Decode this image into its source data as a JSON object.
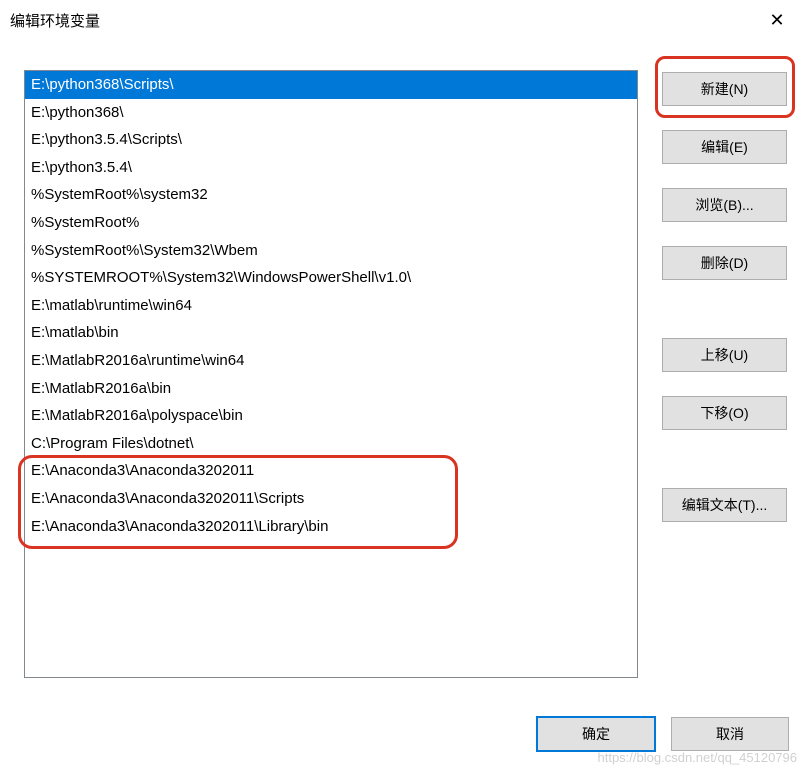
{
  "title": "编辑环境变量",
  "close_symbol": "✕",
  "list": {
    "selected_index": 0,
    "items": [
      "E:\\python368\\Scripts\\",
      "E:\\python368\\",
      "E:\\python3.5.4\\Scripts\\",
      "E:\\python3.5.4\\",
      "%SystemRoot%\\system32",
      "%SystemRoot%",
      "%SystemRoot%\\System32\\Wbem",
      "%SYSTEMROOT%\\System32\\WindowsPowerShell\\v1.0\\",
      "E:\\matlab\\runtime\\win64",
      "E:\\matlab\\bin",
      "E:\\MatlabR2016a\\runtime\\win64",
      "E:\\MatlabR2016a\\bin",
      "E:\\MatlabR2016a\\polyspace\\bin",
      "C:\\Program Files\\dotnet\\",
      "E:\\Anaconda3\\Anaconda3202011",
      "E:\\Anaconda3\\Anaconda3202011\\Scripts",
      "E:\\Anaconda3\\Anaconda3202011\\Library\\bin"
    ]
  },
  "buttons": {
    "new": "新建(N)",
    "edit": "编辑(E)",
    "browse": "浏览(B)...",
    "delete": "删除(D)",
    "moveup": "上移(U)",
    "movedown": "下移(O)",
    "edittext": "编辑文本(T)..."
  },
  "footer": {
    "ok": "确定",
    "cancel": "取消"
  },
  "watermark": "https://blog.csdn.net/qq_45120796"
}
